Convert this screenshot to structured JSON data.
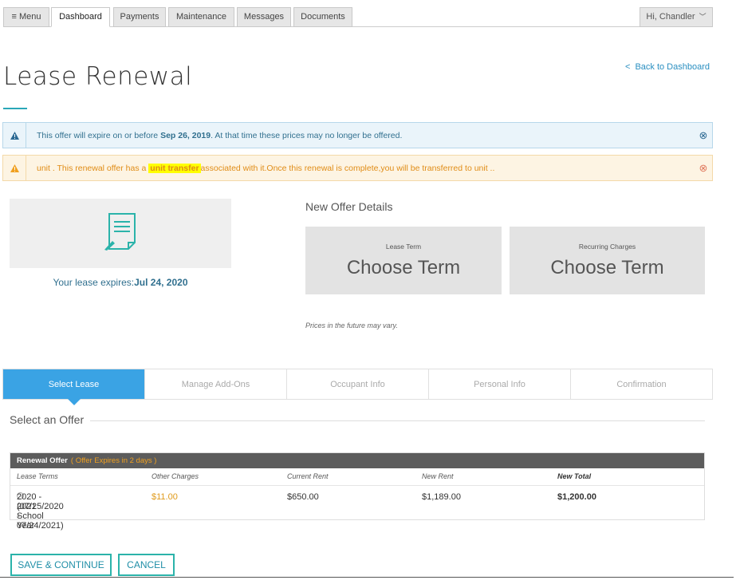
{
  "nav": {
    "menu_label": "Menu",
    "tabs": [
      {
        "label": "Dashboard",
        "active": true
      },
      {
        "label": "Payments",
        "active": false
      },
      {
        "label": "Maintenance",
        "active": false
      },
      {
        "label": "Messages",
        "active": false
      },
      {
        "label": "Documents",
        "active": false
      }
    ],
    "user_greeting": "Hi, Chandler"
  },
  "page": {
    "title": "Lease Renewal",
    "back_link": "Back to Dashboard"
  },
  "alerts": {
    "info": {
      "prefix": "This offer will expire on or before",
      "date": "Sep 26, 2019",
      "suffix": ". At that time these prices may no longer be offered."
    },
    "warning": {
      "prefix": "unit . This renewal offer has a",
      "highlight": "unit transfer",
      "suffix": "associated with it.Once this renewal is complete,you will be transferred to unit .."
    }
  },
  "lease": {
    "expires_label": "Your lease expires:",
    "expires_date": "Jul 24, 2020"
  },
  "offer": {
    "heading": "New Offer Details",
    "cards": [
      {
        "label": "Lease Term",
        "value": "Choose Term"
      },
      {
        "label": "Recurring Charges",
        "value": "Choose Term"
      }
    ],
    "note": "Prices in the future may vary."
  },
  "steps": [
    {
      "label": "Select Lease",
      "active": true
    },
    {
      "label": "Manage Add-Ons",
      "active": false
    },
    {
      "label": "Occupant Info",
      "active": false
    },
    {
      "label": "Personal Info",
      "active": false
    },
    {
      "label": "Confirmation",
      "active": false
    }
  ],
  "select_offer": {
    "heading": "Select an Offer",
    "table": {
      "title": "Renewal Offer",
      "expires_note": "( Offer Expires in 2 days )",
      "columns": [
        "Lease Terms",
        "Other Charges",
        "Current Rent",
        "New Rent",
        "New Total"
      ],
      "rows": [
        {
          "term_line1": "2020 - 2021 School Year",
          "term_line2": "(07/25/2020 - 07/24/2021)",
          "other_charges": "$11.00",
          "current_rent": "$650.00",
          "new_rent": "$1,189.00",
          "new_total": "$1,200.00"
        }
      ]
    }
  },
  "buttons": {
    "save": "SAVE & CONTINUE",
    "cancel": "CANCEL"
  },
  "colors": {
    "accent_blue": "#3aa3e4",
    "teal": "#2bb3aa",
    "warning_orange": "#e08c16"
  }
}
